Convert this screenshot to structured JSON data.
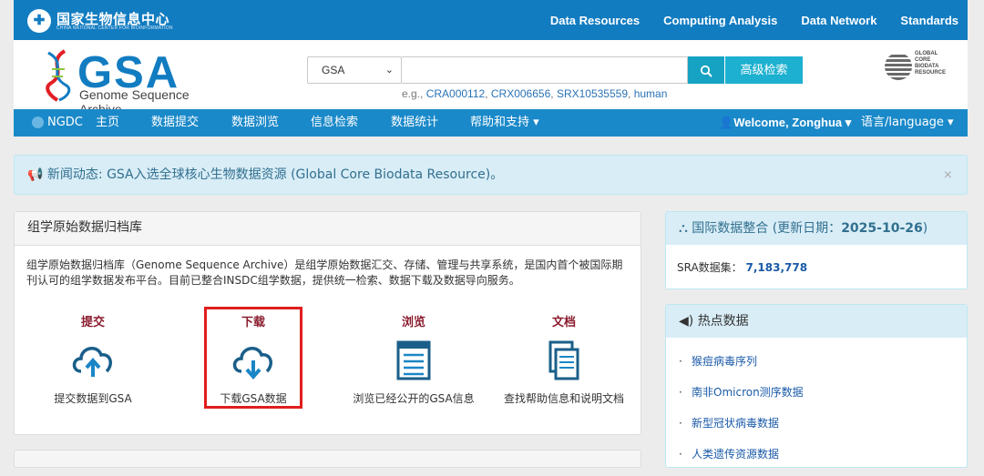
{
  "topbar": {
    "logo_cn": "国家生物信息中心",
    "logo_en": "CHINA NATIONAL CENTER FOR BIOINFORMATION",
    "nav": [
      "Data Resources",
      "Computing Analysis",
      "Data Network",
      "Standards"
    ]
  },
  "header": {
    "logo_word": "GSA",
    "logo_sub": "Genome Sequence Archive",
    "search": {
      "select_value": "GSA",
      "placeholder": "",
      "search_icon": "search-icon",
      "advanced_label": "高级检索",
      "examples_prefix": "e.g.,",
      "examples": [
        "CRA000112",
        "CRX006656",
        "SRX10535559",
        "human"
      ]
    },
    "gcbr_text": [
      "GLOBAL",
      "CORE",
      "BIODATA",
      "RESOURCE"
    ]
  },
  "navbar": {
    "brand": "NGDC",
    "items": [
      "主页",
      "数据提交",
      "数据浏览",
      "信息检索",
      "数据统计",
      "帮助和支持"
    ],
    "user": "Welcome, Zonghua",
    "lang": "语言/language"
  },
  "alert": {
    "prefix": "新闻动态:",
    "text": "GSA入选全球核心生物数据资源 (Global Core Biodata Resource)。",
    "close": "×"
  },
  "main_panel": {
    "title": "组学原始数据归档库",
    "intro": "组学原始数据归档库（Genome Sequence Archive）是组学原始数据汇交、存储、管理与共享系统，是国内首个被国际期刊认可的组学数据发布平台。目前已整合INSDC组学数据，提供统一检索、数据下载及数据导向服务。",
    "actions": [
      {
        "title": "提交",
        "caption": "提交数据到GSA",
        "icon": "cloud-upload-icon"
      },
      {
        "title": "下载",
        "caption": "下载GSA数据",
        "icon": "cloud-download-icon"
      },
      {
        "title": "浏览",
        "caption": "浏览已经公开的GSA信息",
        "icon": "document-list-icon"
      },
      {
        "title": "文档",
        "caption": "查找帮助信息和说明文档",
        "icon": "documents-icon"
      }
    ]
  },
  "side_integration": {
    "title_prefix": "国际数据整合 (更新日期：",
    "date": "2025-10-26",
    "title_suffix": ")",
    "label": "SRA数据集：",
    "count": "7,183,778"
  },
  "side_hot": {
    "title": "热点数据",
    "items": [
      "猴痘病毒序列",
      "南非Omicron测序数据",
      "新型冠状病毒数据",
      "人类遗传资源数据"
    ]
  },
  "colors": {
    "topbar": "#127cc1",
    "navbar": "#1a89c9",
    "accent_red": "#8b1c2e",
    "highlight": "#e01e1e"
  }
}
